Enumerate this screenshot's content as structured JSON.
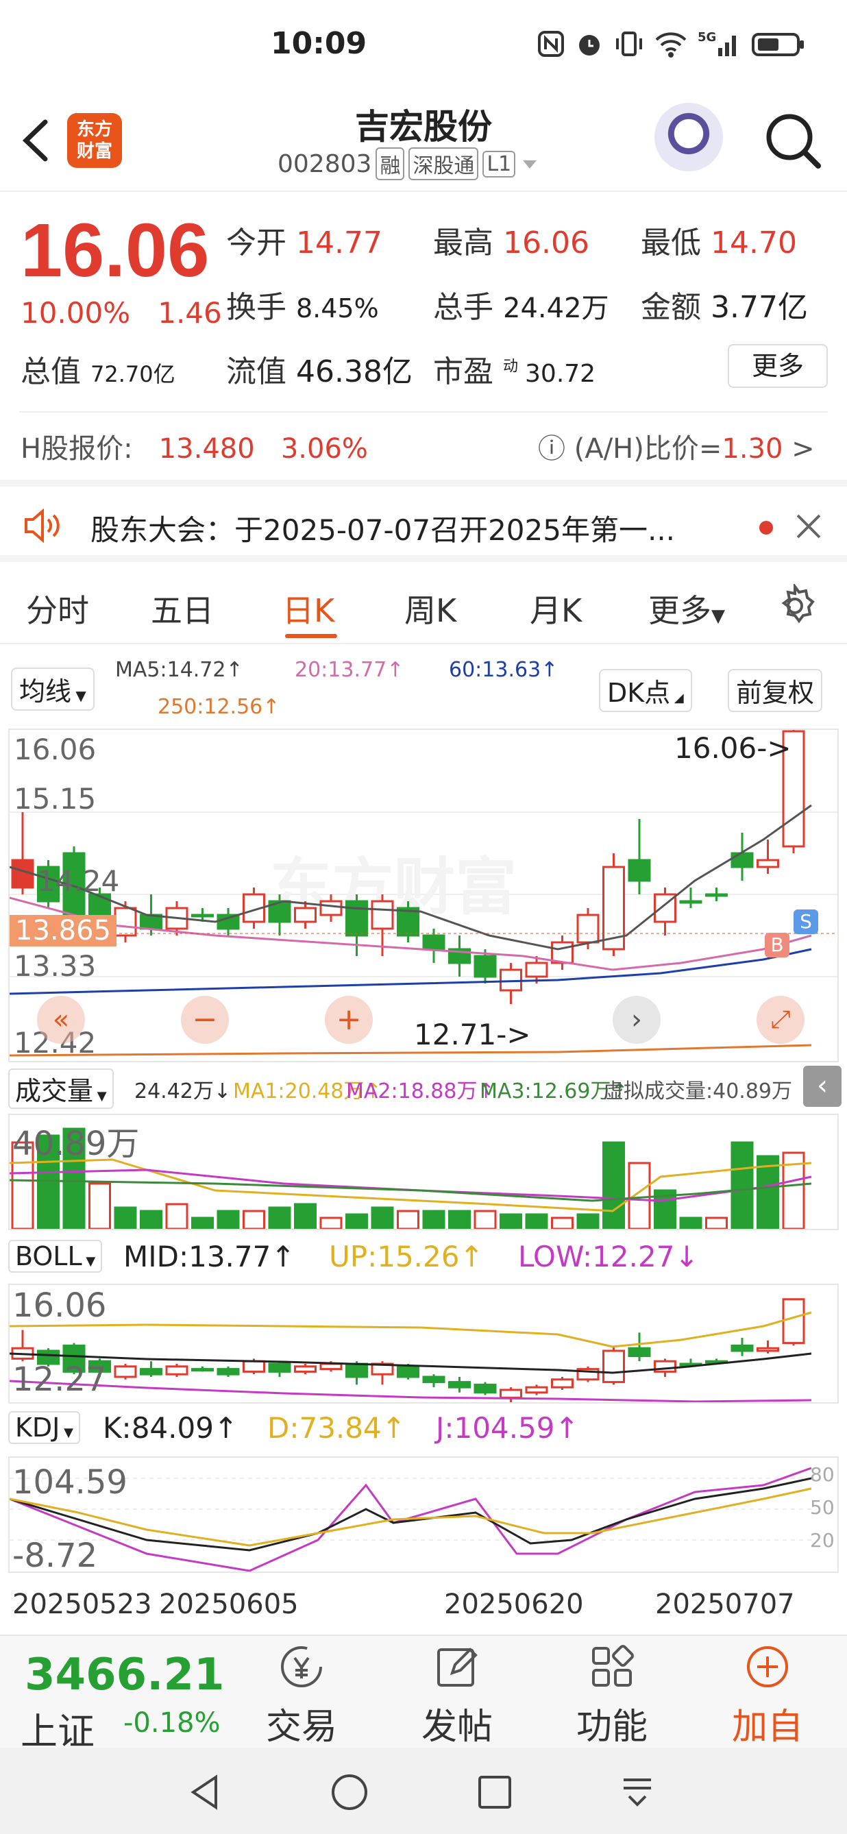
{
  "status_bar": {
    "time": "10:09"
  },
  "header": {
    "title": "吉宏股份",
    "code": "002803",
    "tags": [
      "融",
      "深股通",
      "L1"
    ],
    "logo_text": [
      "东方",
      "财富"
    ]
  },
  "quote": {
    "price": "16.06",
    "change_pct": "10.00%",
    "change_abs": "1.46",
    "open_label": "今开",
    "open": "14.77",
    "high_label": "最高",
    "high": "16.06",
    "low_label": "最低",
    "low": "14.70",
    "turnover_label": "换手",
    "turnover": "8.45%",
    "volume_label": "总手",
    "volume": "24.42万",
    "amount_label": "金额",
    "amount": "3.77亿",
    "mktcap_label": "总值",
    "mktcap": "72.70亿",
    "float_label": "流值",
    "float": "46.38亿",
    "pe_label": "市盈",
    "pe_sup": "动",
    "pe": "30.72",
    "more_label": "更多",
    "h_label": "H股报价:",
    "h_price": "13.480",
    "h_pct": "3.06%",
    "ah_label": "(A/H)比价=",
    "ah_value": "1.30"
  },
  "notice": {
    "text": "股东大会：于2025-07-07召开2025年第一..."
  },
  "tabs": [
    {
      "label": "分时",
      "active": false
    },
    {
      "label": "五日",
      "active": false
    },
    {
      "label": "日K",
      "active": true
    },
    {
      "label": "周K",
      "active": false
    },
    {
      "label": "月K",
      "active": false
    },
    {
      "label": "更多",
      "active": false
    }
  ],
  "ma_row": {
    "selector": "均线",
    "ma5": "MA5:14.72↑",
    "ma20": "20:13.77↑",
    "ma60": "60:13.63↑",
    "ma250": "250:12.56↑",
    "dk_label": "DK点",
    "adjust_label": "前复权"
  },
  "kline": {
    "top": "16.06",
    "mid": "15.15",
    "low_tick1": "14.24",
    "cur": "13.865",
    "low_tick2": "13.33",
    "bottom": "12.42",
    "max_marker": "16.06->",
    "min_marker": "12.71->",
    "buy_badge": "B",
    "sell_badge": "S"
  },
  "volume": {
    "selector": "成交量",
    "vol": "24.42万↓",
    "ma1": "MA1:20.48万↑",
    "ma2": "MA2:18.88万↑",
    "ma3": "MA3:12.69万↑",
    "virtual": "虚拟成交量:40.89万",
    "top": "40.89万"
  },
  "boll": {
    "selector": "BOLL",
    "mid": "MID:13.77↑",
    "up": "UP:15.26↑",
    "low": "LOW:12.27↓",
    "top": "16.06",
    "bottom": "12.27"
  },
  "kdj": {
    "selector": "KDJ",
    "k": "K:84.09↑",
    "d": "D:73.84↑",
    "j": "J:104.59↑",
    "top": "104.59",
    "bottom": "-8.72",
    "levels": [
      "80",
      "50",
      "20"
    ]
  },
  "dates": [
    "20250523",
    "20250605",
    "20250620",
    "20250707"
  ],
  "bottom_bar": {
    "index_value": "3466.21",
    "index_name": "上证",
    "index_change": "-0.18%",
    "items": [
      "交易",
      "发帖",
      "功能",
      "加自选"
    ]
  },
  "colors": {
    "up": "#e03b2f",
    "down": "#26a033",
    "accent": "#e8541a"
  }
}
